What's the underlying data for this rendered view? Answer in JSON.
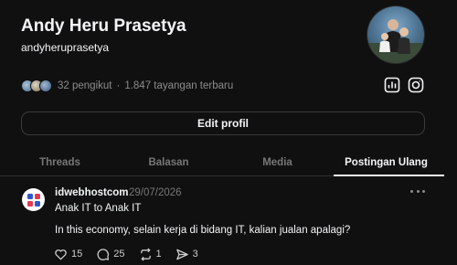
{
  "profile": {
    "name": "Andy Heru Prasetya",
    "handle": "andyheruprasetya",
    "followers_text": "32 pengikut",
    "separator": "·",
    "views_text": "1.847 tayangan terbaru",
    "edit_button_label": "Edit profil"
  },
  "tabs": [
    {
      "label": "Threads",
      "active": false
    },
    {
      "label": "Balasan",
      "active": false
    },
    {
      "label": "Media",
      "active": false
    },
    {
      "label": "Postingan Ulang",
      "active": true
    }
  ],
  "post": {
    "username": "idwebhostcom",
    "date": "29/07/2026",
    "line1": "Anak IT to Anak IT",
    "line2": "In this economy, selain kerja di bidang IT, kalian jualan apalagi?",
    "likes": "15",
    "comments": "25",
    "reposts": "1",
    "shares": "3"
  },
  "icons": {
    "insights": "bar-chart-icon",
    "instagram": "instagram-icon",
    "more": "more-horizontal-icon",
    "like": "heart-icon",
    "comment": "comment-icon",
    "repost": "repost-icon",
    "share": "share-icon"
  },
  "colors": {
    "background": "#101010",
    "text_primary": "#f3f5f7",
    "text_secondary": "#777777",
    "border": "#3a3a3a"
  }
}
